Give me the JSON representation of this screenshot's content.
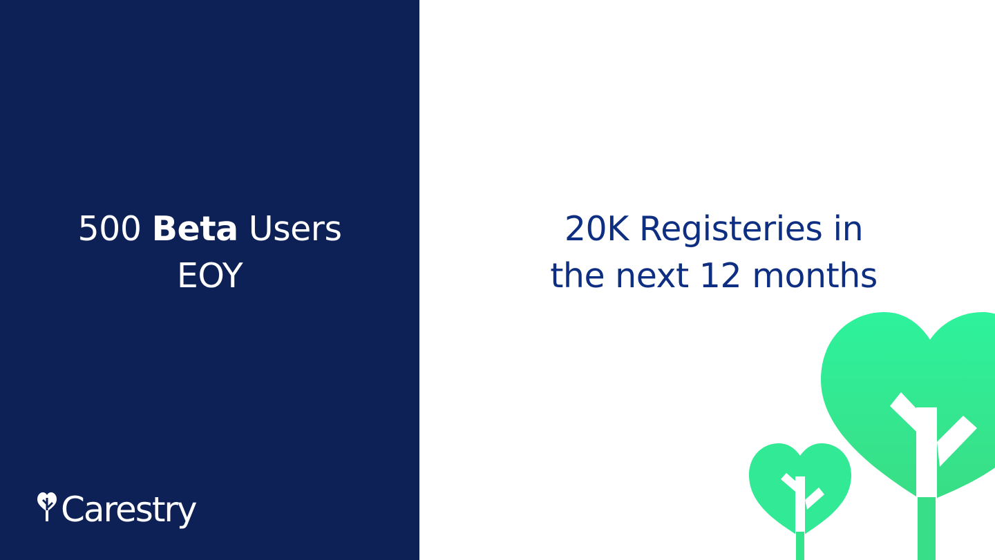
{
  "slide": {
    "left": {
      "headline_line1_pre": "500 ",
      "headline_line1_bold": "Beta",
      "headline_line1_post": " Users",
      "headline_line2": "EOY",
      "background_color": "#0e2156"
    },
    "right": {
      "headline_line1": "20K Registeries in",
      "headline_line2": "the next 12 months",
      "text_color": "#0e2e82"
    },
    "logo": {
      "text": "Carestry",
      "icon": "heart-tree-icon"
    },
    "illustration": {
      "icon": "heart-tree-illustration",
      "color": "#2ee89a"
    }
  }
}
